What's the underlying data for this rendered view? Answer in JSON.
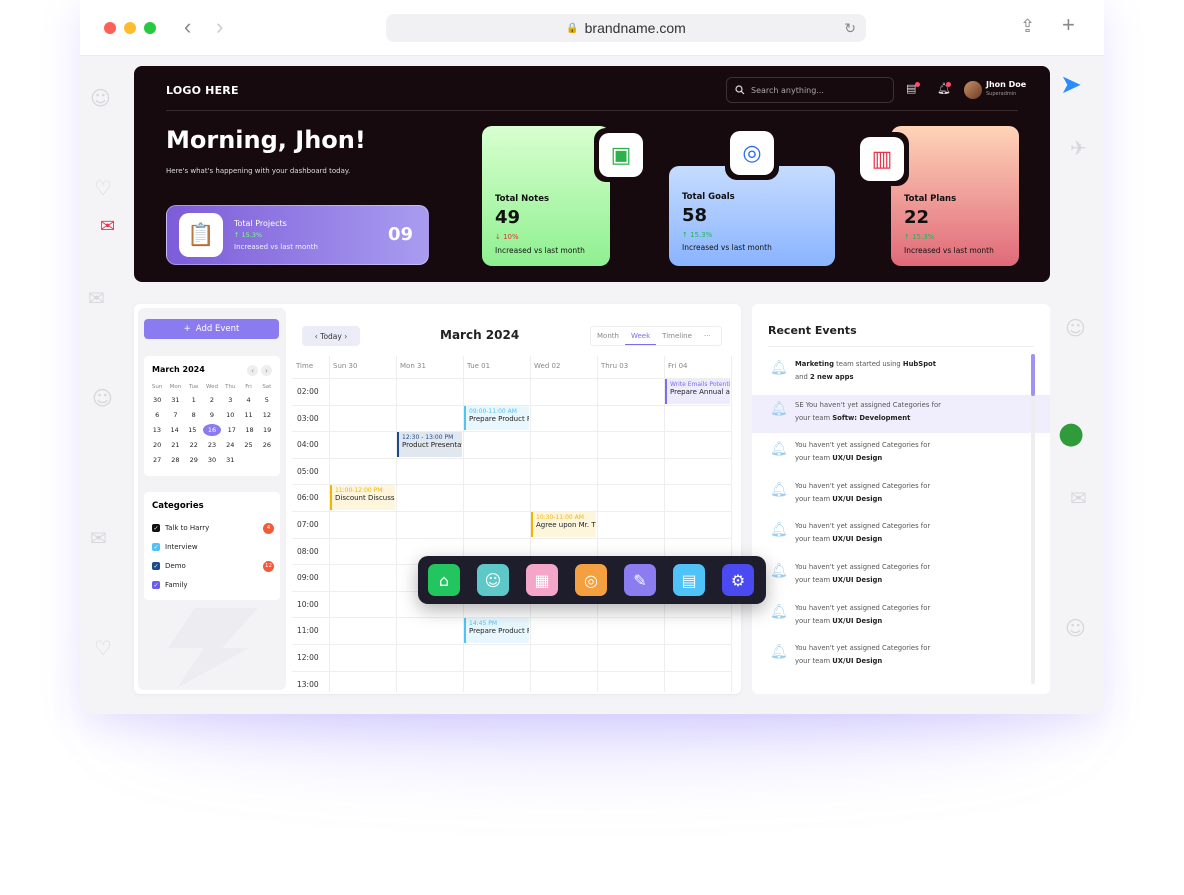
{
  "browser": {
    "url": "brandname.com",
    "back": "‹",
    "forward": "›",
    "share": "⇪",
    "newtab": "+",
    "lock": "🔒",
    "reload": "↻"
  },
  "header": {
    "logo": "LOGO HERE",
    "search_placeholder": "Search anything...",
    "user_name": "Jhon Doe",
    "user_role": "Superadmin"
  },
  "hero": {
    "greeting": "Morning, Jhon!",
    "subtitle": "Here's what's happening with your dashboard today.",
    "projects": {
      "label": "Total Projects",
      "percent": "↑ 15.3%",
      "caption": "Increased vs last month",
      "value": "09"
    }
  },
  "stats": [
    {
      "label": "Total Notes",
      "value": "49",
      "percent": "↓ 10%",
      "caption": "Increased vs last month",
      "icon": "notes-icon"
    },
    {
      "label": "Total Goals",
      "value": "58",
      "percent": "↑ 15.3%",
      "caption": "Increased vs last month",
      "icon": "goals-icon"
    },
    {
      "label": "Total Plans",
      "value": "22",
      "percent": "↑ 15.3%",
      "caption": "Increased vs last month",
      "icon": "plans-icon"
    }
  ],
  "sidebar": {
    "add_event": "Add Event",
    "mini_calendar": {
      "title": "March 2024",
      "weekdays": [
        "Sun",
        "Mon",
        "Tue",
        "Wed",
        "Thu",
        "Fri",
        "Sat"
      ],
      "weeks": [
        [
          "30",
          "31",
          "1",
          "2",
          "3",
          "4",
          "5"
        ],
        [
          "6",
          "7",
          "8",
          "9",
          "10",
          "11",
          "12"
        ],
        [
          "13",
          "14",
          "15",
          "16",
          "17",
          "18",
          "19"
        ],
        [
          "20",
          "21",
          "22",
          "23",
          "24",
          "25",
          "26"
        ],
        [
          "27",
          "28",
          "29",
          "30",
          "31",
          "",
          ""
        ]
      ],
      "selected": "16"
    },
    "categories_title": "Categories",
    "categories": [
      {
        "name": "Talk to Harry",
        "color": "#111111",
        "badge": "4"
      },
      {
        "name": "Interview",
        "color": "#4fc3f7",
        "badge": ""
      },
      {
        "name": "Demo",
        "color": "#1e4a8a",
        "badge": "12"
      },
      {
        "name": "Family",
        "color": "#6c5cf0",
        "badge": ""
      }
    ]
  },
  "calendar": {
    "today_button": "‹ Today ›",
    "title": "March 2024",
    "views": [
      "Month",
      "Week",
      "Timeline",
      "···"
    ],
    "active_view": "Week",
    "time_header": "Time",
    "days": [
      "Sun 30",
      "Mon 31",
      "Tue 01",
      "Wed 02",
      "Thru 03",
      "Fri 04"
    ],
    "times": [
      "02:00",
      "03:00",
      "04:00",
      "05:00",
      "06:00",
      "07:00",
      "08:00",
      "09:00",
      "10:00",
      "11:00",
      "12:00",
      "13:00"
    ],
    "events": [
      {
        "time": "Write Emails Potentia",
        "title": "Prepare Annual ad",
        "day": 5,
        "slot": 0,
        "color": "#7b6df0"
      },
      {
        "time": "09:00-11:00 AM",
        "title": "Prepare Product F",
        "day": 2,
        "slot": 1,
        "color": "#4fc3f7"
      },
      {
        "time": "12:30 - 13:00 PM",
        "title": "Product Presentati",
        "day": 1,
        "slot": 2,
        "color": "#1e4a8a"
      },
      {
        "time": "11:00-12:00 PM",
        "title": "Discount Discussi",
        "day": 0,
        "slot": 4,
        "color": "#f5b400"
      },
      {
        "time": "10:30-11:00 AM",
        "title": "Agree upon Mr. Th",
        "day": 3,
        "slot": 5,
        "color": "#f5b400"
      },
      {
        "time": "14:45 PM",
        "title": "Prepare Product F",
        "day": 2,
        "slot": 9,
        "color": "#4fc3f7"
      }
    ]
  },
  "recent_events": {
    "title": "Recent Events",
    "items": [
      {
        "pre": "",
        "bold1": "Marketing",
        "mid": " team started using ",
        "bold2": "HubSpot",
        "line2a": "and ",
        "line2b": "2 new apps",
        "highlight": false
      },
      {
        "pre": "",
        "bold1": "",
        "mid": "SE You haven't yet assigned Categories for",
        "bold2": "",
        "line2a": "your team ",
        "line2b": "Softw: Development",
        "highlight": true
      },
      {
        "pre": "",
        "bold1": "",
        "mid": "You haven't yet assigned Categories for",
        "bold2": "",
        "line2a": "your team ",
        "line2b": "UX/UI Design",
        "highlight": false
      },
      {
        "pre": "",
        "bold1": "",
        "mid": "You haven't yet assigned Categories for",
        "bold2": "",
        "line2a": "your team ",
        "line2b": "UX/UI Design",
        "highlight": false
      },
      {
        "pre": "",
        "bold1": "",
        "mid": "You haven't yet assigned Categories for",
        "bold2": "",
        "line2a": "your team ",
        "line2b": "UX/UI Design",
        "highlight": false
      },
      {
        "pre": "",
        "bold1": "",
        "mid": "You haven't yet assigned Categories for",
        "bold2": "",
        "line2a": "your team ",
        "line2b": "UX/UI Design",
        "highlight": false
      },
      {
        "pre": "",
        "bold1": "",
        "mid": "You haven't yet assigned Categories for",
        "bold2": "",
        "line2a": "your team ",
        "line2b": "UX/UI Design",
        "highlight": false
      },
      {
        "pre": "",
        "bold1": "",
        "mid": "You haven't yet assigned Categories for",
        "bold2": "",
        "line2a": "your team ",
        "line2b": "UX/UI Design",
        "highlight": false
      }
    ]
  },
  "dock": [
    {
      "name": "home-icon",
      "glyph": "⌂",
      "color": "#22c55e"
    },
    {
      "name": "chat-bot-icon",
      "glyph": "☺",
      "color": "#5ec8c8"
    },
    {
      "name": "calendar-icon",
      "glyph": "▦",
      "color": "#f4a6c8"
    },
    {
      "name": "target-icon",
      "glyph": "◎",
      "color": "#f5a040"
    },
    {
      "name": "edit-note-icon",
      "glyph": "✎",
      "color": "#8b7cf0"
    },
    {
      "name": "clipboard-icon",
      "glyph": "▤",
      "color": "#4fc3f7"
    },
    {
      "name": "settings-icon",
      "glyph": "⚙",
      "color": "#4a4af0"
    }
  ]
}
